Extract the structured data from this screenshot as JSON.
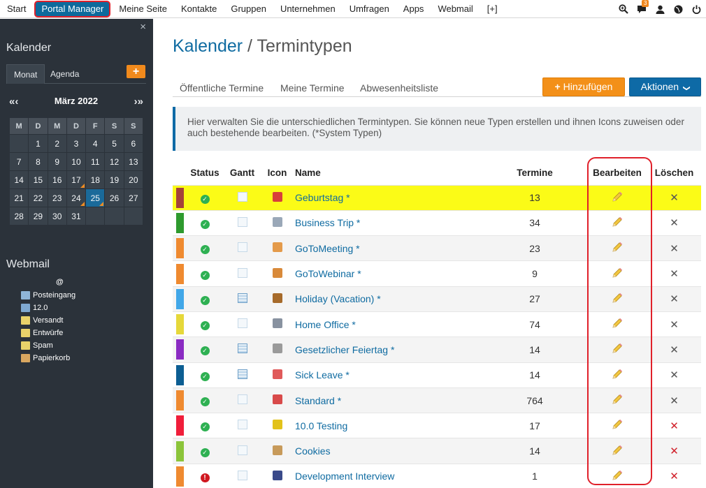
{
  "topnav": {
    "items": [
      "Start",
      "Portal Manager",
      "Meine Seite",
      "Kontakte",
      "Gruppen",
      "Unternehmen",
      "Umfragen",
      "Apps",
      "Webmail",
      "[+]"
    ],
    "active_index": 1,
    "icons": [
      "search-plus-icon",
      "chat-icon",
      "user-icon",
      "globe-icon",
      "power-icon"
    ],
    "chat_badge": "3"
  },
  "sidebar": {
    "close": "×",
    "calendar_title": "Kalender",
    "tabs": [
      "Monat",
      "Agenda"
    ],
    "add_label": "+",
    "month_title": "März 2022",
    "prev_label": "«‹",
    "next_label": "›»",
    "weekdays": [
      "M",
      "D",
      "M",
      "D",
      "F",
      "S",
      "S"
    ],
    "weeks": [
      [
        "",
        "1",
        "2",
        "3",
        "4",
        "5",
        "6"
      ],
      [
        "7",
        "8",
        "9",
        "10",
        "11",
        "12",
        "13"
      ],
      [
        "14",
        "15",
        "16",
        "17",
        "18",
        "19",
        "20"
      ],
      [
        "21",
        "22",
        "23",
        "24",
        "25",
        "26",
        "27"
      ],
      [
        "28",
        "29",
        "30",
        "31",
        "",
        "",
        ""
      ]
    ],
    "today": "25",
    "marked_days": [
      "17",
      "24",
      "25"
    ],
    "webmail_title": "Webmail",
    "webmail_account": "@",
    "folders": [
      {
        "label": "Posteingang",
        "icon": "inbox-icon",
        "color": "#8fb5d8"
      },
      {
        "label": "12.0",
        "icon": "folder-icon",
        "color": "#7fa9d1"
      },
      {
        "label": "Versandt",
        "icon": "sent-icon",
        "color": "#e9d26a"
      },
      {
        "label": "Entwürfe",
        "icon": "drafts-icon",
        "color": "#e9d26a"
      },
      {
        "label": "Spam",
        "icon": "spam-icon",
        "color": "#e9d26a"
      },
      {
        "label": "Papierkorb",
        "icon": "trash-icon",
        "color": "#d9a760"
      }
    ]
  },
  "main": {
    "breadcrumb_link": "Kalender",
    "breadcrumb_sep": " / ",
    "page_title": "Termintypen",
    "tabs": [
      "Öffentliche Termine",
      "Meine Termine",
      "Abwesenheitsliste"
    ],
    "add_button": "Hinzufügen",
    "actions_button": "Aktionen",
    "info_text": "Hier verwalten Sie die unterschiedlichen Termintypen. Sie können neue Typen erstellen und ihnen Icons zuweisen oder auch bestehende bearbeiten. (*System Typen)",
    "columns": [
      "Status",
      "Gantt",
      "Icon",
      "Name",
      "Termine",
      "Bearbeiten",
      "Löschen"
    ],
    "rows": [
      {
        "color": "#a4423a",
        "status": "ok",
        "gantt": false,
        "icon": "gift-icon",
        "icon_color": "#d8403a",
        "name": "Geburtstag *",
        "count": "13",
        "delete_red": false
      },
      {
        "color": "#2e9a2e",
        "status": "ok",
        "gantt": false,
        "icon": "id-card-icon",
        "icon_color": "#9aa8b8",
        "name": "Business Trip *",
        "count": "34",
        "delete_red": false
      },
      {
        "color": "#ef8a30",
        "status": "ok",
        "gantt": false,
        "icon": "person-icon",
        "icon_color": "#e49a4a",
        "name": "GoToMeeting *",
        "count": "23",
        "delete_red": false
      },
      {
        "color": "#ef8a30",
        "status": "ok",
        "gantt": false,
        "icon": "people-icon",
        "icon_color": "#d98a3a",
        "name": "GoToWebinar *",
        "count": "9",
        "delete_red": false
      },
      {
        "color": "#41a7e8",
        "status": "ok",
        "gantt": true,
        "icon": "suitcase-icon",
        "icon_color": "#a66a2a",
        "name": "Holiday (Vacation) *",
        "count": "27",
        "delete_red": false
      },
      {
        "color": "#e6d83a",
        "status": "ok",
        "gantt": false,
        "icon": "computer-icon",
        "icon_color": "#8892a0",
        "name": "Home Office *",
        "count": "74",
        "delete_red": false
      },
      {
        "color": "#8a2bc2",
        "status": "ok",
        "gantt": true,
        "icon": "bank-icon",
        "icon_color": "#9a9a9a",
        "name": "Gesetzlicher Feiertag *",
        "count": "14",
        "delete_red": false
      },
      {
        "color": "#0c5e92",
        "status": "ok",
        "gantt": true,
        "icon": "pill-icon",
        "icon_color": "#e05a5a",
        "name": "Sick Leave *",
        "count": "14",
        "delete_red": false
      },
      {
        "color": "#ef8a30",
        "status": "ok",
        "gantt": false,
        "icon": "calendar-icon",
        "icon_color": "#d84a4a",
        "name": "Standard *",
        "count": "764",
        "delete_red": false
      },
      {
        "color": "#f01e3a",
        "status": "ok",
        "gantt": false,
        "icon": "radiation-icon",
        "icon_color": "#e2c21a",
        "name": "10.0 Testing",
        "count": "17",
        "delete_red": true
      },
      {
        "color": "#8bc43a",
        "status": "ok",
        "gantt": false,
        "icon": "cookie-icon",
        "icon_color": "#c79a5a",
        "name": "Cookies",
        "count": "14",
        "delete_red": true
      },
      {
        "color": "#ef8a30",
        "status": "warn",
        "gantt": false,
        "icon": "interview-icon",
        "icon_color": "#3a4a8a",
        "name": "Development Interview",
        "count": "1",
        "delete_red": true
      }
    ]
  },
  "glyphs": {
    "check": "✓",
    "warn": "!",
    "x": "✕",
    "chevron": "❯"
  }
}
